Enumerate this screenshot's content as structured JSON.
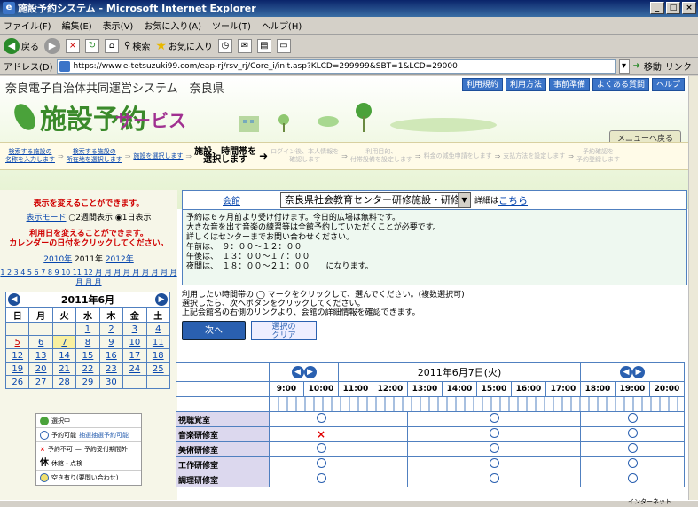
{
  "window": {
    "title": "施設予約システム - Microsoft Internet Explorer"
  },
  "menu": [
    "ファイル(F)",
    "編集(E)",
    "表示(V)",
    "お気に入り(A)",
    "ツール(T)",
    "ヘルプ(H)"
  ],
  "toolbar": {
    "back": "戻る",
    "search": "検索",
    "favorites": "お気に入り"
  },
  "address": {
    "label": "アドレス(D)",
    "url": "https://www.e-tetsuzuki99.com/eap-rj/rsv_rj/Core_i/init.asp?KLCD=299999&SBT=1&LCD=29000",
    "go": "移動",
    "links": "リンク"
  },
  "site": {
    "system_title": "奈良電子自治体共同運営システム　奈良県",
    "logo_big": "施設予約",
    "logo_small": "サービス",
    "nav": [
      "利用規約",
      "利用方法",
      "事前準備",
      "よくある質問",
      "ヘルプ"
    ],
    "menu_return": "メニューへ戻る"
  },
  "steps": [
    "検索する施設の\n名称を入力します",
    "検索する施設の\n所在地を選択します",
    "施設を選択します",
    "施設、時間帯を\n選択します",
    "ログイン後、本人情報を\n確認します",
    "利用目的、\n付帯設備を設定します",
    "料金の減免申請をします",
    "支払方法を設定します",
    "予約確認を\n予約登録します"
  ],
  "left": {
    "note1": "表示を変えることができます。",
    "mode_label": "表示モード",
    "mode_2w": "2週間表示",
    "mode_1d": "1日表示",
    "note2": "利用日を変えることができます。\nカレンダーの日付をクリックしてください。",
    "years": [
      "2010年",
      "2011年",
      "2012年"
    ],
    "months": "1 2 3 4 5 6 7 8 9 10 11 12 月 月 月 月 月 月 月 月 月 月 月 月"
  },
  "calendar": {
    "title": "2011年6月",
    "weekdays": [
      "日",
      "月",
      "火",
      "水",
      "木",
      "金",
      "土"
    ],
    "weeks": [
      [
        "",
        "",
        "",
        "1",
        "2",
        "3",
        "4"
      ],
      [
        "5",
        "6",
        "7",
        "8",
        "9",
        "10",
        "11"
      ],
      [
        "12",
        "13",
        "14",
        "15",
        "16",
        "17",
        "18"
      ],
      [
        "19",
        "20",
        "21",
        "22",
        "23",
        "24",
        "25"
      ],
      [
        "26",
        "27",
        "28",
        "29",
        "30",
        "",
        ""
      ]
    ]
  },
  "legend": [
    "選択中",
    "予約可能",
    "抽選抽選予約可能",
    "予約不可",
    "予約受付期間外",
    "休館・点検",
    "空き有り(要問い合わせ)"
  ],
  "facility": {
    "label": "会館",
    "selected": "奈良県社会教育センター研修施設・研修棟",
    "detail": "詳細は",
    "detail_link": "こちら"
  },
  "notice": "予約は６ヶ月前より受け付けます。今日的広場は無料です。\n大きな音を出す音楽の練習等は全館予約していただくことが必要です。\n詳しくはセンターまでお問い合わせください。\n午前は、　９：００～１２：００\n午後は、　１３：００～１７：００\n夜間は、　１８：００～２１：００　　になります。",
  "instructions": [
    "利用したい時間帯の ◯ マークをクリックして、選んでください。(複数選択可)",
    "選択したら、次へボタンをクリックしてください。",
    "上記会館名の右側のリンクより、会館の詳細情報を確認できます。"
  ],
  "buttons": {
    "next": "次へ",
    "clear": "選択の\nクリア"
  },
  "schedule": {
    "date": "2011年6月7日(火)",
    "times": [
      "9:00",
      "10:00",
      "11:00",
      "12:00",
      "13:00",
      "14:00",
      "15:00",
      "16:00",
      "17:00",
      "18:00",
      "19:00",
      "20:00"
    ],
    "rooms": [
      {
        "name": "視聴覚室",
        "slots": [
          "am",
          "pm",
          "ev"
        ]
      },
      {
        "name": "音楽研修室",
        "slots": [
          "x",
          "pm",
          "ev"
        ]
      },
      {
        "name": "美術研修室",
        "slots": [
          "am",
          "pm",
          "ev"
        ]
      },
      {
        "name": "工作研修室",
        "slots": [
          "am",
          "pm",
          "ev"
        ]
      },
      {
        "name": "調理研修室",
        "slots": [
          "am",
          "pm",
          "ev"
        ]
      }
    ]
  },
  "status": {
    "zone": "インターネット"
  }
}
